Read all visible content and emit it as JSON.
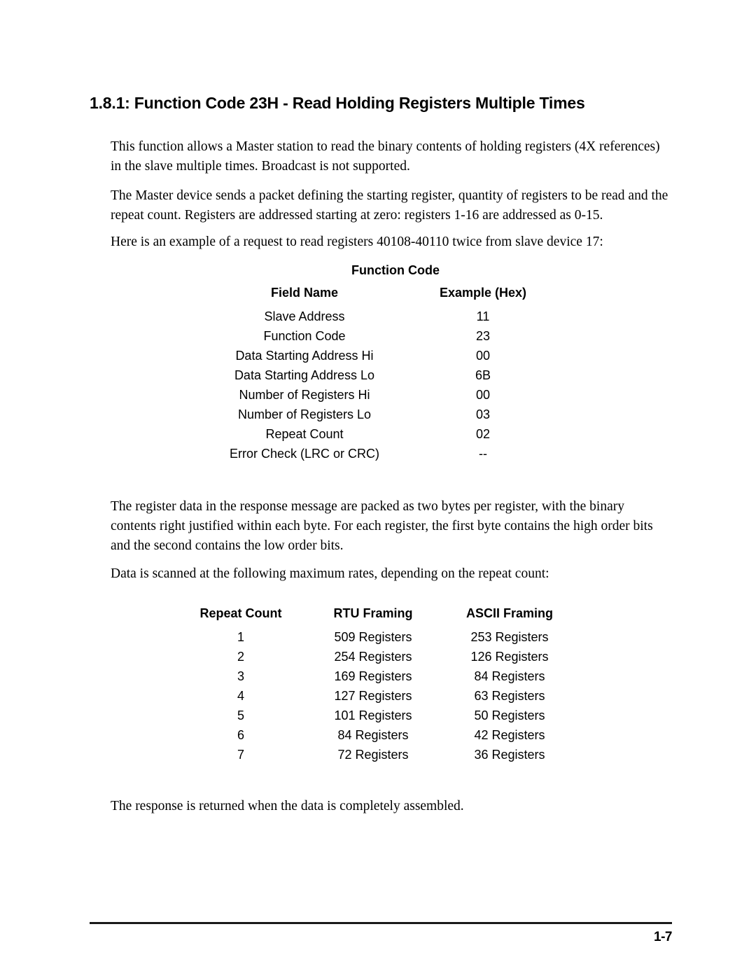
{
  "heading": {
    "text": "1.8.1: Function Code 23H - Read Holding Registers Multiple Times"
  },
  "paragraphs": {
    "intro": "This function allows a Master station to read the binary contents of holding registers (4X references) in the slave multiple times.  Broadcast is not supported.",
    "master_device": "The Master device sends a packet defining the starting register, quantity of registers to be read and the repeat count.  Registers are addressed starting at zero: registers 1-16 are addressed as 0-15.",
    "example_intro": "Here is an example of a request to read registers 40108-40110 twice from slave device 17:",
    "packed_data": "The register data in the response message are packed as two bytes per register, with the binary contents right justified within each byte.  For each register, the first byte contains the high order bits and the second contains the low order bits.",
    "scan_rates_intro": "Data is scanned at the following maximum rates, depending on the repeat count:",
    "response": "The response is returned when the data is completely assembled."
  },
  "function_code_table": {
    "title": "Function Code",
    "headers": [
      "Field Name",
      "Example (Hex)"
    ],
    "rows": [
      [
        "Slave Address",
        "11"
      ],
      [
        "Function Code",
        "23"
      ],
      [
        "Data Starting Address Hi",
        "00"
      ],
      [
        "Data Starting Address Lo",
        "6B"
      ],
      [
        "Number of Registers Hi",
        "00"
      ],
      [
        "Number of Registers Lo",
        "03"
      ],
      [
        "Repeat Count",
        "02"
      ],
      [
        "Error Check (LRC or CRC)",
        "--"
      ]
    ]
  },
  "scan_rate_table": {
    "headers": [
      "Repeat Count",
      "RTU Framing",
      "ASCII Framing"
    ],
    "rows": [
      [
        "1",
        "509 Registers",
        "253 Registers"
      ],
      [
        "2",
        "254 Registers",
        "126 Registers"
      ],
      [
        "3",
        "169 Registers",
        "84 Registers"
      ],
      [
        "4",
        "127 Registers",
        "63 Registers"
      ],
      [
        "5",
        "101 Registers",
        "50 Registers"
      ],
      [
        "6",
        "84 Registers",
        "42 Registers"
      ],
      [
        "7",
        "72 Registers",
        "36 Registers"
      ]
    ]
  },
  "footer": {
    "page_number": "1-7"
  }
}
